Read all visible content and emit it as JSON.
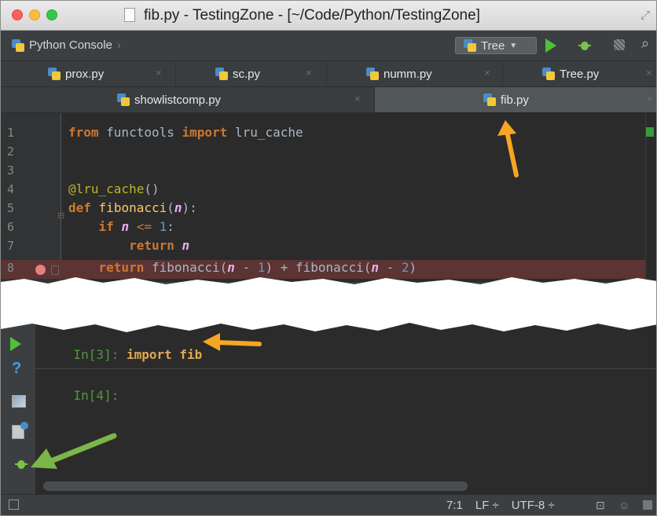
{
  "window": {
    "title": "fib.py - TestingZone - [~/Code/Python/TestingZone]"
  },
  "navbar": {
    "breadcrumb": "Python Console",
    "run_config": "Tree"
  },
  "tabs_row1": [
    {
      "label": "prox.py",
      "close": "×"
    },
    {
      "label": "sc.py",
      "close": "×"
    },
    {
      "label": "numm.py",
      "close": "×"
    },
    {
      "label": "Tree.py",
      "close": "×"
    }
  ],
  "tabs_row2": [
    {
      "label": "showlistcomp.py",
      "close": "×",
      "active": false
    },
    {
      "label": "fib.py",
      "close": "×",
      "active": true
    }
  ],
  "editor": {
    "line_numbers": [
      "1",
      "2",
      "3",
      "4",
      "5",
      "6",
      "7",
      "8"
    ],
    "lines": [
      "from functools import lru_cache",
      "",
      "",
      "@lru_cache()",
      "def fibonacci(n):",
      "    if n <= 1:",
      "        return n",
      "    return fibonacci(n - 1) + fibonacci(n - 2)"
    ],
    "breakpoint_line": 8
  },
  "console": {
    "prompts": [
      {
        "prompt": "In[3]:",
        "command": "import fib"
      },
      {
        "prompt": "In[4]:",
        "command": ""
      }
    ],
    "help_icon": "?"
  },
  "statusbar": {
    "position": "7:1",
    "line_sep": "LF ÷",
    "encoding": "UTF-8 ÷"
  },
  "colors": {
    "keyword": "#cc7832",
    "function": "#ffc66d",
    "param": "#e6b0f0",
    "decorator": "#bbb529",
    "number": "#6897bb",
    "prompt": "#4e9a3a",
    "arrow_orange": "#f5a623",
    "arrow_green": "#7ab648"
  },
  "icons": {
    "run": "play-icon",
    "debug": "bug-icon",
    "coverage": "coverage-icon",
    "search": "search-icon"
  }
}
